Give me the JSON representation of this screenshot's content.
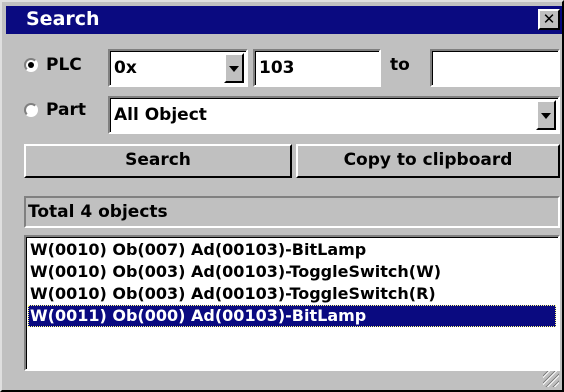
{
  "window": {
    "title": "Search",
    "close_glyph": "✕"
  },
  "plc": {
    "label": "PLC",
    "selected": true,
    "type_value": "0x",
    "address_value": "103",
    "to_label": "to",
    "to_value": ""
  },
  "part": {
    "label": "Part",
    "selected": false,
    "value": "All Object"
  },
  "buttons": {
    "search": "Search",
    "copy": "Copy to clipboard"
  },
  "status": {
    "text": "Total 4 objects"
  },
  "results": [
    {
      "text": "W(0010) Ob(007) Ad(00103)-BitLamp",
      "selected": false
    },
    {
      "text": "W(0010) Ob(003) Ad(00103)-ToggleSwitch(W)",
      "selected": false
    },
    {
      "text": "W(0010) Ob(003) Ad(00103)-ToggleSwitch(R)",
      "selected": false
    },
    {
      "text": "W(0011) Ob(000) Ad(00103)-BitLamp",
      "selected": true
    }
  ],
  "colors": {
    "titlebar": "#0a0a80",
    "face": "#c0c0c0",
    "selection": "#0a0a80"
  },
  "icons": {
    "close": "close-icon",
    "dropdown": "chevron-down-icon",
    "resize": "resize-grip-icon"
  }
}
